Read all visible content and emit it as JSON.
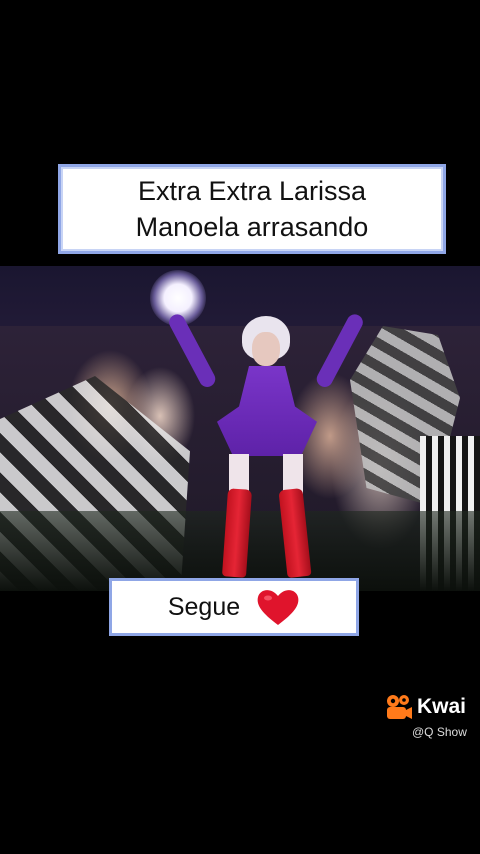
{
  "caption": {
    "line1": "Extra Extra Larissa",
    "line2": "Manoela arrasando"
  },
  "follow": {
    "label": "Segue",
    "icon": "heart-icon"
  },
  "watermark": {
    "brand": "Kwai",
    "handle": "@Q Show"
  },
  "colors": {
    "background": "#000000",
    "box_border": "#8fa6e6",
    "heart": "#e0142c",
    "kwai_accent": "#ff7a1a"
  }
}
